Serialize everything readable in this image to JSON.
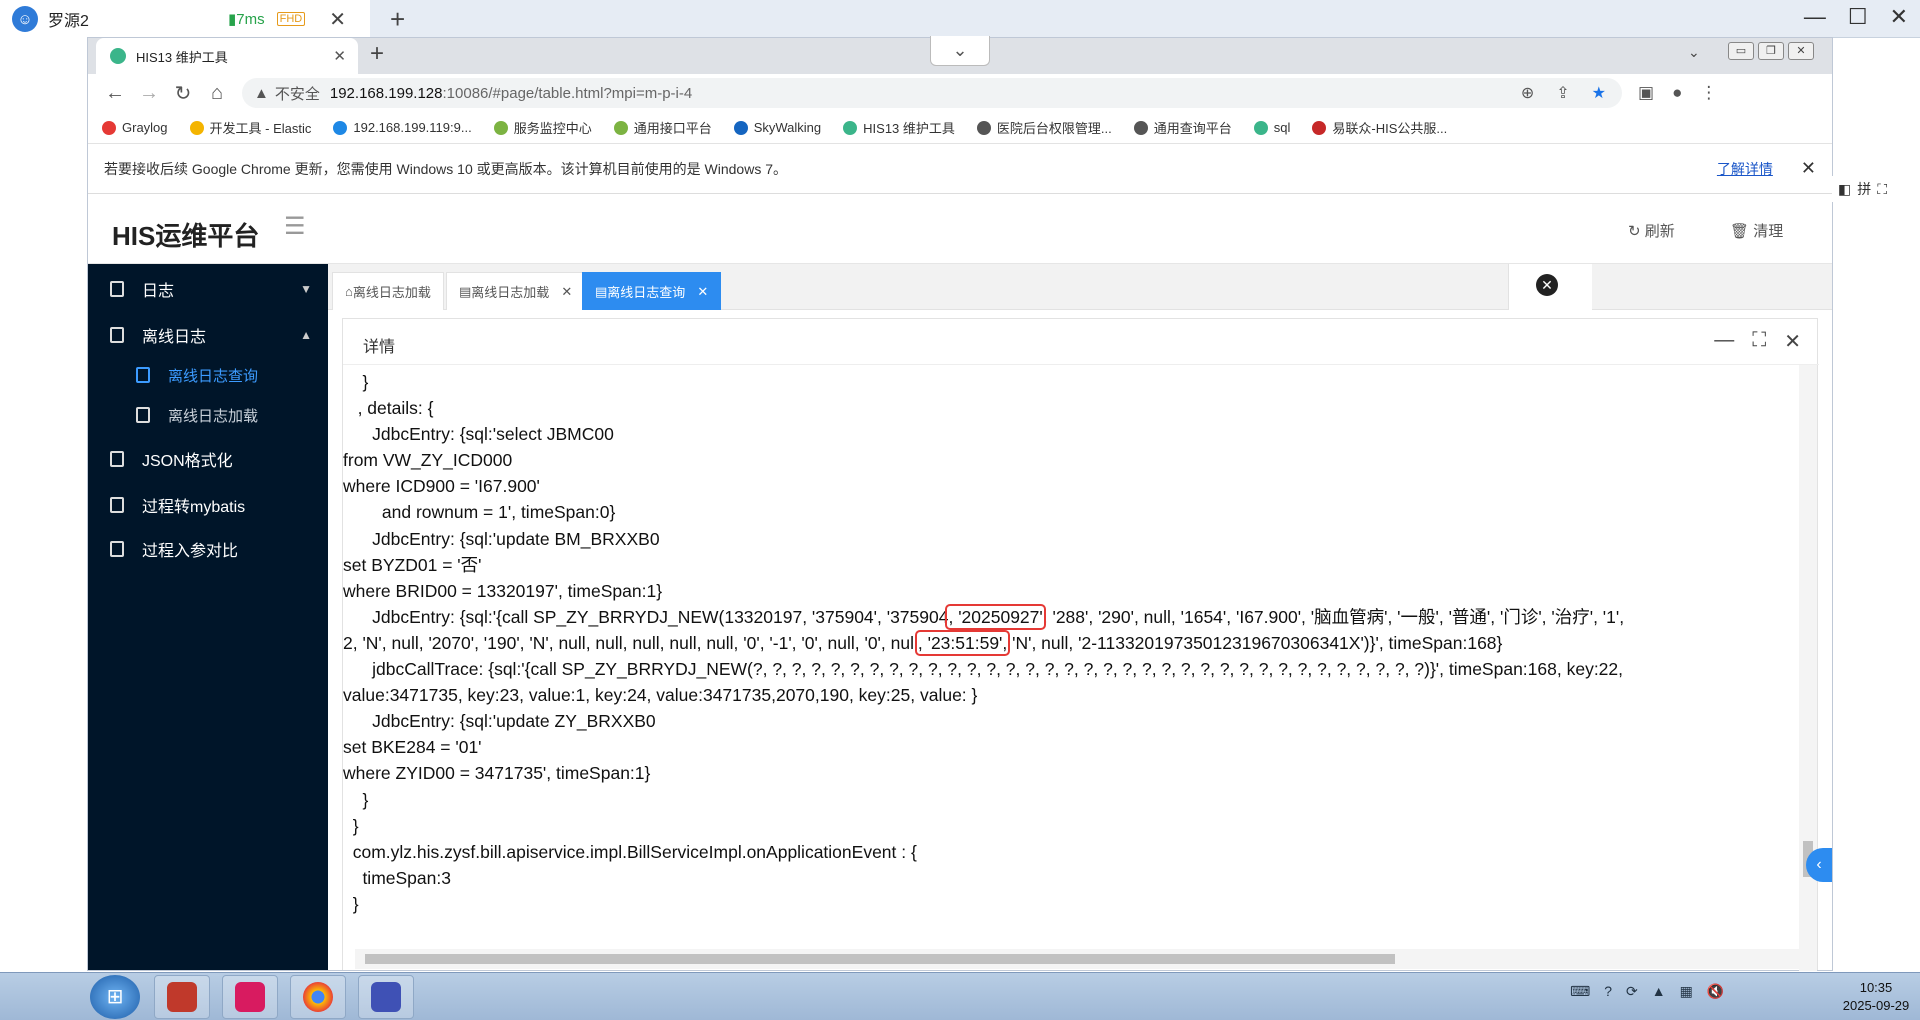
{
  "remote": {
    "title": "罗源2",
    "ping": "7ms",
    "quality": "FHD"
  },
  "browser": {
    "tab_title": "HIS13 维护工具",
    "not_secure": "不安全",
    "url_host": "192.168.199.128",
    "url_rest": ":10086/#page/table.html?mpi=m-p-i-4",
    "bookmarks": [
      "Graylog",
      "开发工具 - Elastic",
      "192.168.199.119:9...",
      "服务监控中心",
      "通用接口平台",
      "SkyWalking",
      "HIS13 维护工具",
      "医院后台权限管理...",
      "通用查询平台",
      "sql",
      "易联众-HIS公共服..."
    ],
    "infobar_text": "若要接收后续 Google Chrome 更新，您需使用 Windows 10 或更高版本。该计算机目前使用的是 Windows 7。",
    "infobar_link": "了解详情"
  },
  "app": {
    "title": "HIS运维平台",
    "refresh": "刷新",
    "clear": "清理"
  },
  "sidebar": {
    "items": [
      {
        "label": "日志"
      },
      {
        "label": "离线日志"
      },
      {
        "label": "离线日志查询"
      },
      {
        "label": "离线日志加载"
      },
      {
        "label": "JSON格式化"
      },
      {
        "label": "过程转mybatis"
      },
      {
        "label": "过程入参对比"
      }
    ]
  },
  "tabs": [
    "离线日志加载",
    "离线日志加载",
    "离线日志查询"
  ],
  "detail": {
    "title": "详情"
  },
  "code": {
    "l01": "    }",
    "l02": "   , details: {",
    "l03": "      JdbcEntry: {sql:'select JBMC00",
    "l04": "from VW_ZY_ICD000",
    "l05": "where ICD900 = 'I67.900'",
    "l06": "        and rownum = 1', timeSpan:0}",
    "l07": "      JdbcEntry: {sql:'update BM_BRXXB0",
    "l08": "set BYZD01 = '否'",
    "l09": "where BRID00 = 13320197', timeSpan:1}",
    "l10a": "      JdbcEntry: {sql:'{call SP_ZY_BRRYDJ_NEW(13320197, '375904', '375904",
    "l10hl": ", '20250927'",
    "l10b": ", '288', '290', null, '1654', 'I67.900', '脑血管病', '一般', '普通', '门诊', '治疗', '1',",
    "l11a": "2, 'N', null, '2070', '190', 'N', null, null, null, null, null, '0', '-1', '0', null, '0', null",
    "l11hl": ", '23:51:59',",
    "l11b": " 'N', null, '2-1133201973501231967030634​1X')}', timeSpan:168}",
    "l12": "      jdbcCallTrace: {sql:'{call SP_ZY_BRRYDJ_NEW(?, ?, ?, ?, ?, ?, ?, ?, ?, ?, ?, ?, ?, ?, ?, ?, ?, ?, ?, ?, ?, ?, ?, ?, ?, ?, ?, ?, ?, ?, ?, ?, ?, ?, ?)}', timeSpan:168, key:22,",
    "l13": "value:3471735, key:23, value:1, key:24, value:3471735,2070,190, key:25, value: }",
    "l14": "      JdbcEntry: {sql:'update ZY_BRXXB0",
    "l15": "set BKE284 = '01'",
    "l16": "where ZYID00 = 3471735', timeSpan:1}",
    "l17": "    }",
    "l18": "  }",
    "l19": "  com.ylz.his.zysf.bill.apiservice.impl.BillServiceImpl.onApplicationEvent : {",
    "l20": "    timeSpan:3",
    "l21": "  }"
  },
  "taskbar": {
    "time": "10:35",
    "date": "2025-09-29"
  }
}
